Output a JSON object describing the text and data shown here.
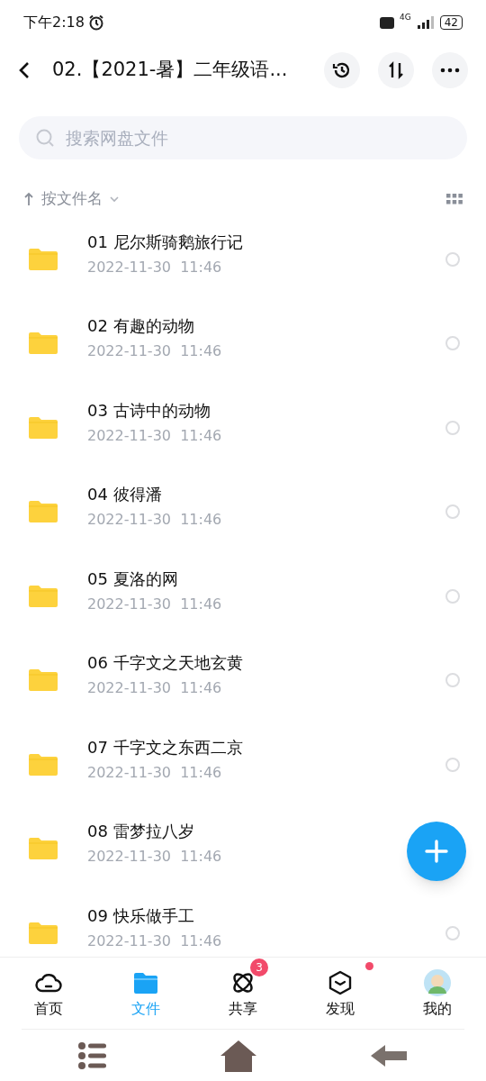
{
  "status_bar": {
    "time": "下午2:18",
    "network": "4G",
    "battery": "42"
  },
  "header": {
    "title": "02.【2021-暑】二年级语..."
  },
  "search": {
    "placeholder": "搜索网盘文件"
  },
  "sort": {
    "label": "按文件名"
  },
  "files": [
    {
      "name": "01 尼尔斯骑鹅旅行记",
      "date": "2022-11-30  11:46",
      "selected": false
    },
    {
      "name": "02 有趣的动物",
      "date": "2022-11-30  11:46",
      "selected": false
    },
    {
      "name": "03 古诗中的动物",
      "date": "2022-11-30  11:46",
      "selected": false
    },
    {
      "name": "04 彼得潘",
      "date": "2022-11-30  11:46",
      "selected": false
    },
    {
      "name": "05 夏洛的网",
      "date": "2022-11-30  11:46",
      "selected": false
    },
    {
      "name": "06 千字文之天地玄黄",
      "date": "2022-11-30  11:46",
      "selected": false
    },
    {
      "name": "07 千字文之东西二京",
      "date": "2022-11-30  11:46",
      "selected": false
    },
    {
      "name": "08 雷梦拉八岁",
      "date": "2022-11-30  11:46"
    },
    {
      "name": "09 快乐做手工",
      "date": "2022-11-30  11:46",
      "selected": false
    }
  ],
  "tabs": [
    {
      "label": "首页",
      "kind": "home",
      "selected": false
    },
    {
      "label": "文件",
      "kind": "files",
      "selected": true
    },
    {
      "label": "共享",
      "kind": "share",
      "selected": false,
      "badge": "3"
    },
    {
      "label": "发现",
      "kind": "discover",
      "selected": false,
      "dot": true
    },
    {
      "label": "我的",
      "kind": "me",
      "selected": false
    }
  ]
}
